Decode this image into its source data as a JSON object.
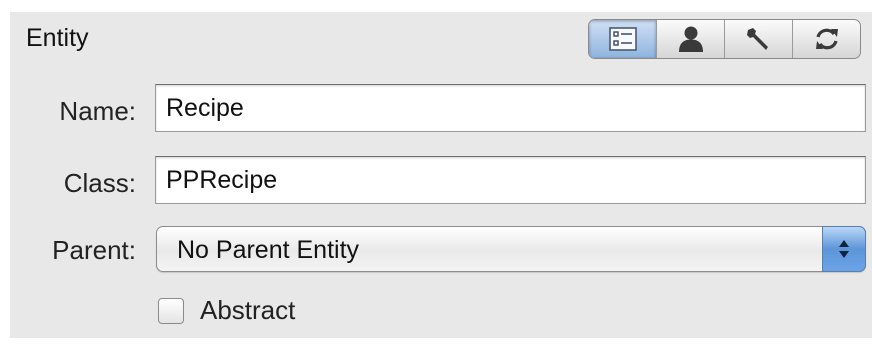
{
  "section": {
    "title": "Entity"
  },
  "toolbar": {
    "buttons": [
      {
        "icon": "list-properties-icon",
        "active": true
      },
      {
        "icon": "user-icon",
        "active": false
      },
      {
        "icon": "wrench-icon",
        "active": false
      },
      {
        "icon": "sync-icon",
        "active": false
      }
    ]
  },
  "fields": {
    "name_label": "Name:",
    "name_value": "Recipe",
    "class_label": "Class:",
    "class_value": "PPRecipe",
    "parent_label": "Parent:",
    "parent_value": "No Parent Entity"
  },
  "abstract": {
    "label": "Abstract",
    "checked": false
  },
  "colors": {
    "panel_bg": "#e8e8e8",
    "accent_blue": "#5d95d9"
  }
}
